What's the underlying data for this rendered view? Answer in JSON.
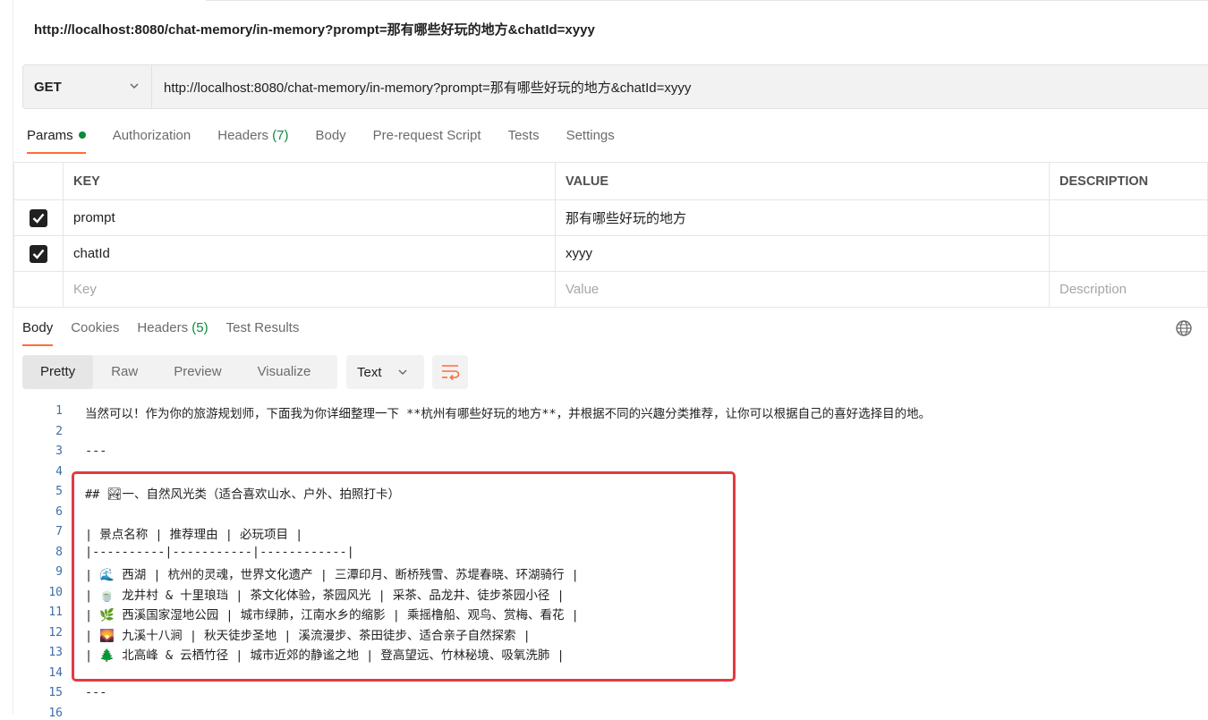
{
  "window": {
    "title_url": "http://localhost:8080/chat-memory/in-memory?prompt=那有哪些好玩的地方&chatId=xyyy"
  },
  "request": {
    "method": "GET",
    "url": "http://localhost:8080/chat-memory/in-memory?prompt=那有哪些好玩的地方&chatId=xyyy"
  },
  "request_tabs": [
    {
      "label": "Params",
      "active": true
    },
    {
      "label": "Authorization"
    },
    {
      "label": "Headers",
      "count": "(7)"
    },
    {
      "label": "Body"
    },
    {
      "label": "Pre-request Script"
    },
    {
      "label": "Tests"
    },
    {
      "label": "Settings"
    }
  ],
  "params_table": {
    "headers": [
      "KEY",
      "VALUE",
      "DESCRIPTION"
    ],
    "rows": [
      {
        "checked": true,
        "key": "prompt",
        "value": "那有哪些好玩的地方",
        "description": ""
      },
      {
        "checked": true,
        "key": "chatId",
        "value": "xyyy",
        "description": ""
      }
    ],
    "placeholders": {
      "key": "Key",
      "value": "Value",
      "description": "Description"
    }
  },
  "response_tabs": [
    {
      "label": "Body",
      "active": true
    },
    {
      "label": "Cookies"
    },
    {
      "label": "Headers",
      "count": "(5)"
    },
    {
      "label": "Test Results"
    }
  ],
  "view_modes": [
    "Pretty",
    "Raw",
    "Preview",
    "Visualize"
  ],
  "active_view": "Pretty",
  "format": "Text",
  "icons": {
    "method_dropdown": "chevron-down-icon",
    "format_dropdown": "chevron-down-icon",
    "wrap": "wrap-lines-icon",
    "globe": "globe-icon",
    "check": "check-icon"
  },
  "colors": {
    "accent": "#ff6c37",
    "active_dot": "#0c8a3c",
    "count": "#0c8a3c",
    "highlight_border": "#e23b3f",
    "line_numbers": "#3f6ea5"
  },
  "response_body": [
    {
      "n": "1",
      "text": "当然可以！作为你的旅游规划师，下面我为你详细整理一下 **杭州有哪些好玩的地方**，并根据不同的兴趣分类推荐，让你可以根据自己的喜好选择目的地。"
    },
    {
      "n": "2",
      "text": ""
    },
    {
      "n": "3",
      "text": "---"
    },
    {
      "n": "4",
      "text": ""
    },
    {
      "n": "5",
      "text": "## 🏞一、自然风光类（适合喜欢山水、户外、拍照打卡）"
    },
    {
      "n": "6",
      "text": ""
    },
    {
      "n": "7",
      "text": "| 景点名称 | 推荐理由 | 必玩项目 |"
    },
    {
      "n": "8",
      "text": "|----------|-----------|------------|"
    },
    {
      "n": "9",
      "text": "| 🌊 西湖 | 杭州的灵魂，世界文化遗产 | 三潭印月、断桥残雪、苏堤春晓、环湖骑行 |"
    },
    {
      "n": "10",
      "text": "| 🍵 龙井村 & 十里琅珰 | 茶文化体验，茶园风光 | 采茶、品龙井、徒步茶园小径 |"
    },
    {
      "n": "11",
      "text": "| 🌿 西溪国家湿地公园 | 城市绿肺，江南水乡的缩影 | 乘摇橹船、观鸟、赏梅、看花 |"
    },
    {
      "n": "12",
      "text": "| 🌄 九溪十八涧 | 秋天徒步圣地 | 溪流漫步、茶田徒步、适合亲子自然探索 |"
    },
    {
      "n": "13",
      "text": "| 🌲 北高峰 & 云栖竹径 | 城市近郊的静谧之地 | 登高望远、竹林秘境、吸氧洗肺 |"
    },
    {
      "n": "14",
      "text": ""
    },
    {
      "n": "15",
      "text": "---"
    },
    {
      "n": "16",
      "text": ""
    }
  ]
}
